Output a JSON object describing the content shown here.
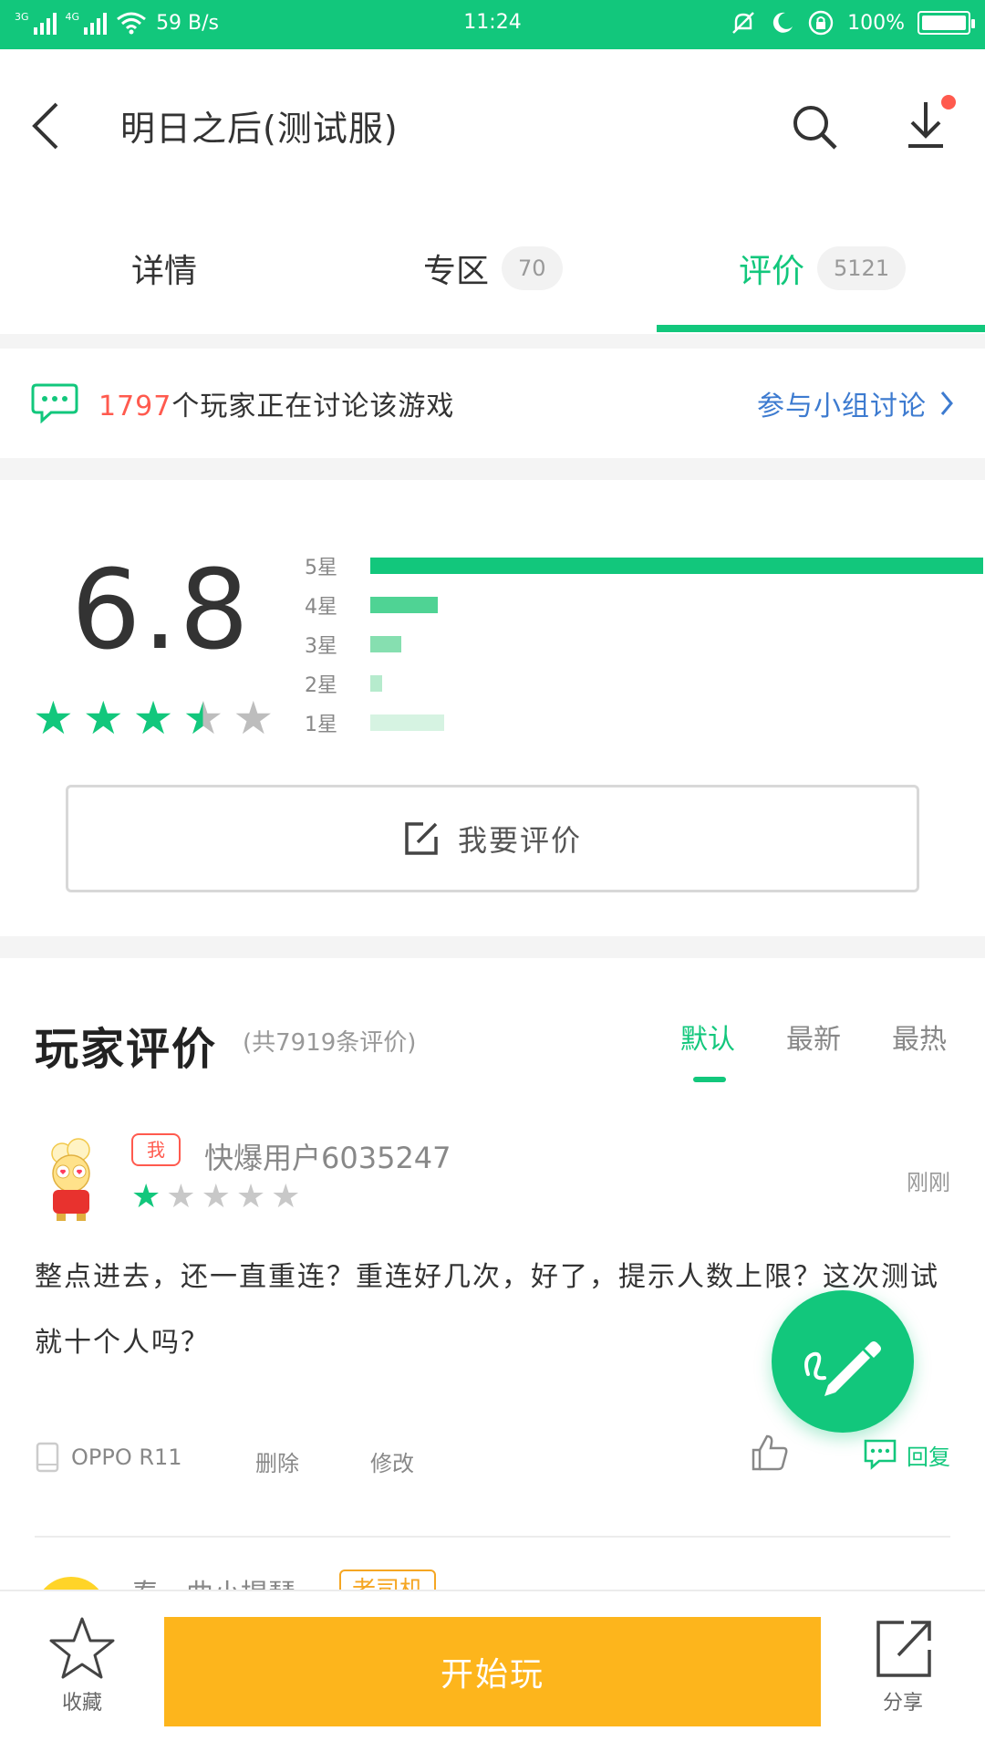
{
  "status_bar": {
    "net1": "3G",
    "net2": "4G",
    "speed": "59 B/s",
    "time": "11:24",
    "battery": "100%"
  },
  "header": {
    "title": "明日之后(测试服)"
  },
  "tabs": [
    {
      "label": "详情",
      "count": ""
    },
    {
      "label": "专区",
      "count": "70"
    },
    {
      "label": "评价",
      "count": "5121"
    }
  ],
  "active_tab": 2,
  "discussion": {
    "count": "1797",
    "text": "个玩家正在讨论该游戏",
    "link": "参与小组讨论"
  },
  "rating": {
    "score": "6.8",
    "stars": 3.5,
    "distribution": [
      {
        "label": "5星",
        "fraction": 1.0,
        "color": "#12c77c"
      },
      {
        "label": "4星",
        "fraction": 0.11,
        "color": "#4fd394"
      },
      {
        "label": "3星",
        "fraction": 0.05,
        "color": "#86dfb0"
      },
      {
        "label": "2星",
        "fraction": 0.02,
        "color": "#b6ebcd"
      },
      {
        "label": "1星",
        "fraction": 0.12,
        "color": "#d6f3e2"
      }
    ],
    "write_button": "我要评价"
  },
  "reviews_section": {
    "title": "玩家评价",
    "count_text": "(共7919条评价)",
    "sort_options": [
      "默认",
      "最新",
      "最热"
    ],
    "active_sort": 0
  },
  "review": {
    "badge": "我",
    "username": "快爆用户6035247",
    "stars": 1,
    "time": "刚刚",
    "content": "整点进去，还一直重连？重连好几次，好了，提示人数上限？这次测试就十个人吗？",
    "device": "OPPO R11",
    "delete": "删除",
    "edit": "修改",
    "reply": "回复"
  },
  "next_review": {
    "username": "春一曲小提琴",
    "badge": "老司机"
  },
  "bottom_bar": {
    "collect": "收藏",
    "play": "开始玩",
    "share": "分享"
  },
  "colors": {
    "brand": "#12c77c",
    "accent_red": "#ff5a4e",
    "link_blue": "#3d7bd0",
    "play_orange": "#fdb51c"
  }
}
